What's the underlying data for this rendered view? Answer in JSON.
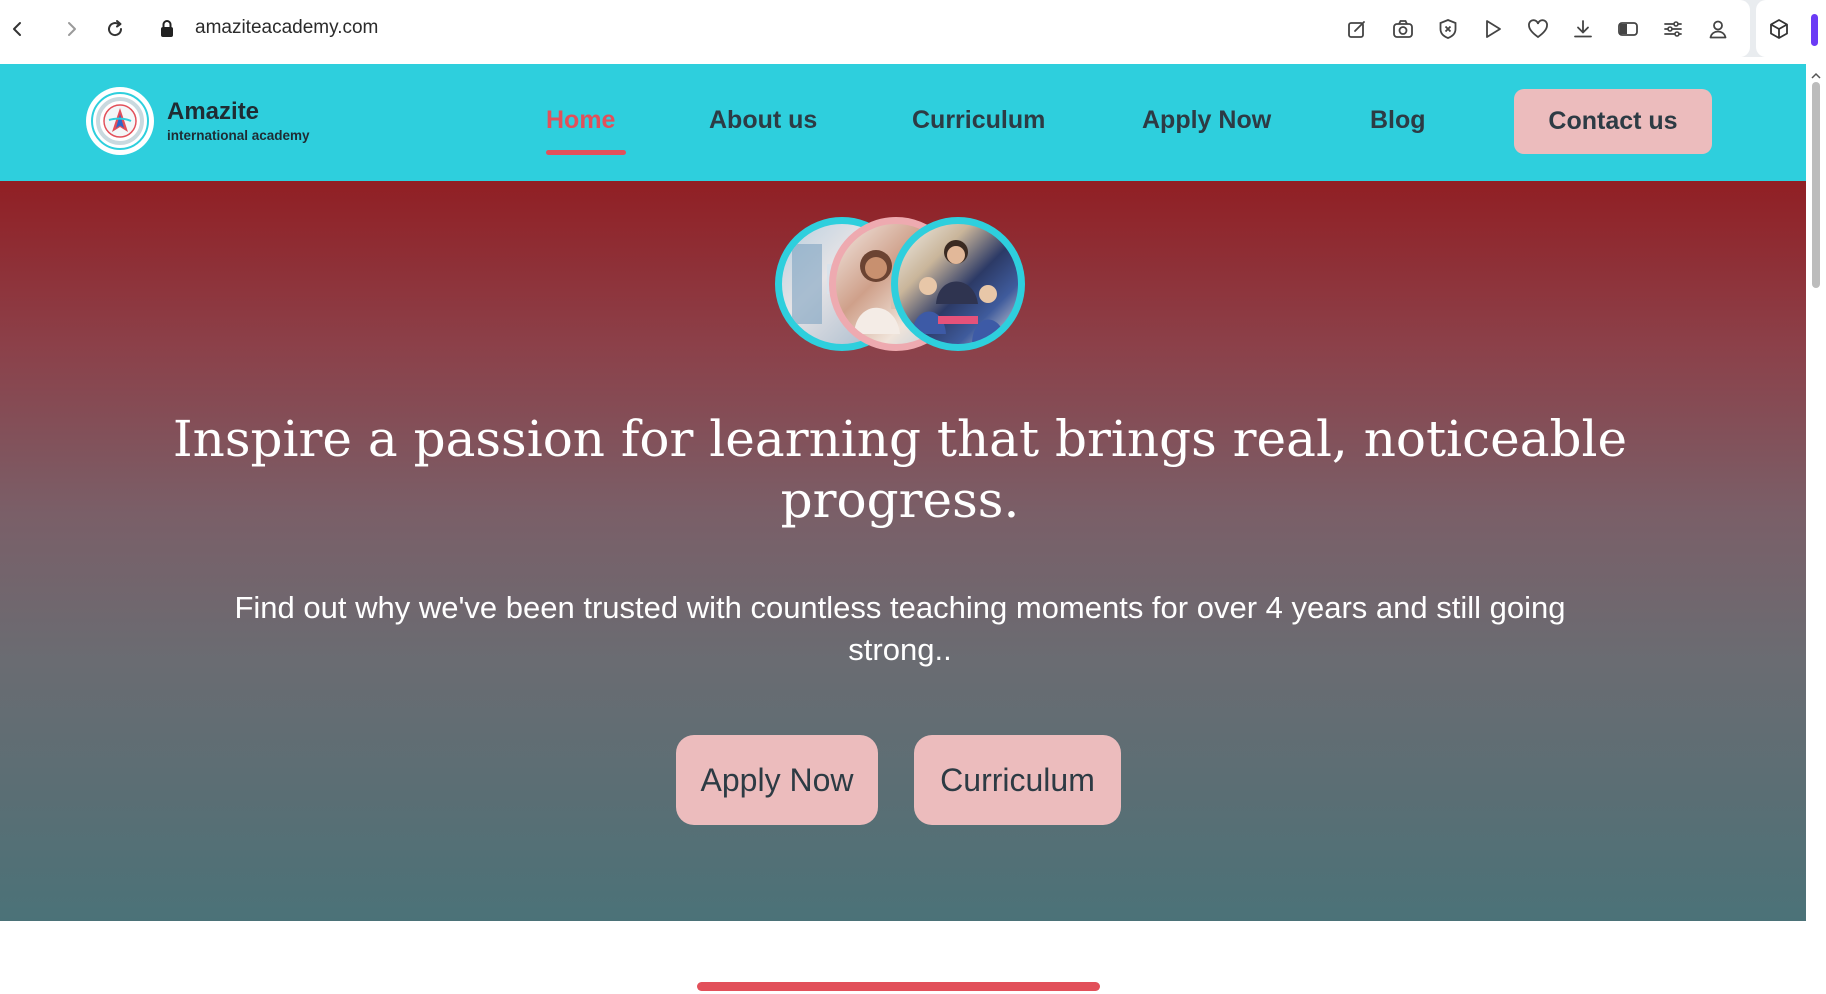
{
  "browser": {
    "url": "amaziteacademy.com",
    "icons": [
      "back-icon",
      "forward-icon",
      "reload-icon",
      "lock-icon",
      "edit-icon",
      "camera-icon",
      "shield-icon",
      "play-icon",
      "heart-icon",
      "download-icon",
      "sidebar-toggle-icon",
      "settings-icon",
      "profile-icon",
      "extensions-icon"
    ]
  },
  "header": {
    "brand_name": "Amazite",
    "brand_sub": "international academy",
    "nav": {
      "home": "Home",
      "about": "About us",
      "curriculum": "Curriculum",
      "apply": "Apply Now",
      "blog": "Blog"
    },
    "contact_label": "Contact us",
    "active_item": "Home"
  },
  "hero": {
    "title": "Inspire a passion for learning that brings real, noticeable progress.",
    "subtitle": "Find out why we've been trusted with countless teaching moments for over 4 years and still going strong..",
    "apply_label": "Apply Now",
    "curriculum_label": "Curriculum"
  },
  "colors": {
    "header_bg": "#2ecfdd",
    "accent_red": "#e2505a",
    "button_pink": "#ecbcbd",
    "hero_top": "#911f24",
    "hero_bottom": "#4b7278"
  }
}
